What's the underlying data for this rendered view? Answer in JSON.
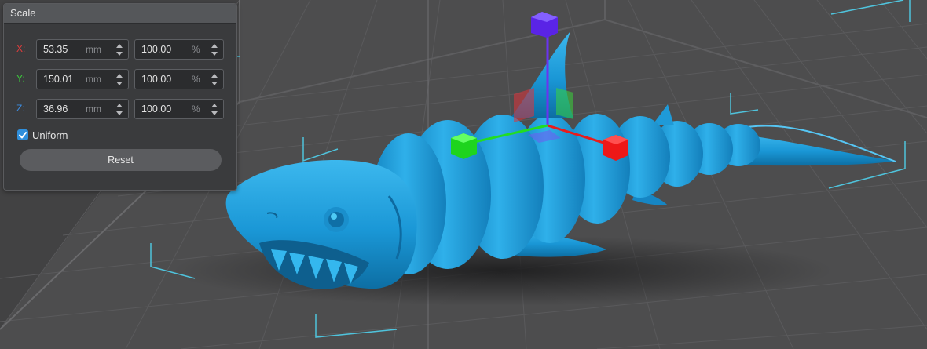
{
  "panel": {
    "title": "Scale",
    "rows": [
      {
        "axis": "X:",
        "color": "#e03c3c",
        "value": "53.35",
        "unit": "mm",
        "percent": "100.00",
        "percent_unit": "%"
      },
      {
        "axis": "Y:",
        "color": "#3cc83c",
        "value": "150.01",
        "unit": "mm",
        "percent": "100.00",
        "percent_unit": "%"
      },
      {
        "axis": "Z:",
        "color": "#3c8ce0",
        "value": "36.96",
        "unit": "mm",
        "percent": "100.00",
        "percent_unit": "%"
      }
    ],
    "uniform": {
      "label": "Uniform",
      "checked": true
    },
    "reset_label": "Reset"
  },
  "viewport": {
    "background": "#4a4a4b",
    "model_color": "#1b9ad8",
    "bbox_color": "#4fc3dc",
    "gizmo": {
      "x_color": "#e81c1c",
      "y_color": "#22dd22",
      "z_color": "#6a34f0"
    }
  }
}
